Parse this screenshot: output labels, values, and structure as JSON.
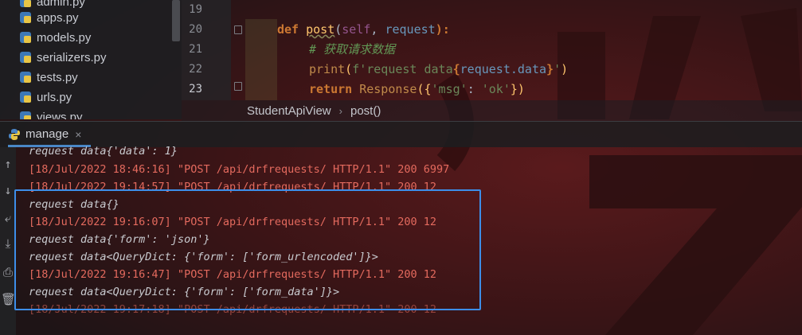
{
  "project_tree": {
    "files": [
      {
        "name": "admin.py"
      },
      {
        "name": "apps.py"
      },
      {
        "name": "models.py"
      },
      {
        "name": "serializers.py"
      },
      {
        "name": "tests.py"
      },
      {
        "name": "urls.py"
      },
      {
        "name": "views.py"
      }
    ]
  },
  "editor": {
    "line_numbers": [
      "19",
      "20",
      "21",
      "22",
      "23"
    ],
    "code": {
      "l20": {
        "def": "def ",
        "name": "post",
        "open": "(",
        "self": "self",
        "comma": ", ",
        "param": "request",
        "close": "):"
      },
      "l21": {
        "comment": "# 获取请求数据"
      },
      "l22": {
        "print": "print",
        "open": "(",
        "str": "f'request data",
        "brace_o": "{",
        "expr": "request.data",
        "brace_c": "}",
        "str_end": "'",
        "close": ")"
      },
      "l23": {
        "ret": "return ",
        "cls": "Response",
        "open": "({",
        "key": "'msg'",
        "colon": ": ",
        "val": "'ok'",
        "close": "})"
      }
    }
  },
  "breadcrumb": {
    "class_name": "StudentApiView",
    "method": "post()"
  },
  "run_tab": {
    "label": "manage",
    "close": "×"
  },
  "toolbar": {
    "up": "↑",
    "down": "↓",
    "wrap": "⤶",
    "scroll_end": "⤓",
    "print": "⎙",
    "trash": "🗑"
  },
  "console": {
    "lines": [
      {
        "text": "request data{'data': 1}"
      },
      {
        "text": "[18/Jul/2022 18:46:16] \"POST /api/drfrequests/ HTTP/1.1\" 200 6997"
      },
      {
        "text": "[18/Jul/2022 19:14:57] \"POST /api/drfrequests/ HTTP/1.1\" 200 12"
      },
      {
        "text": "request data{}"
      },
      {
        "text": "[18/Jul/2022 19:16:07] \"POST /api/drfrequests/ HTTP/1.1\" 200 12"
      },
      {
        "text": "request data{'form': 'json'}"
      },
      {
        "text": "request data<QueryDict: {'form': ['form_urlencoded']}>"
      },
      {
        "text": "[18/Jul/2022 19:16:47] \"POST /api/drfrequests/ HTTP/1.1\" 200 12"
      },
      {
        "text": "request data<QueryDict: {'form': ['form_data']}>"
      },
      {
        "text": "[18/Jul/2022 19:17:18] \"POST /api/drfrequests/ HTTP/1.1\" 200 12"
      }
    ]
  },
  "colors": {
    "highlight_box": "#3d8ee8",
    "log_red": "#e46a5e",
    "tab_accent": "#4a88c7"
  }
}
